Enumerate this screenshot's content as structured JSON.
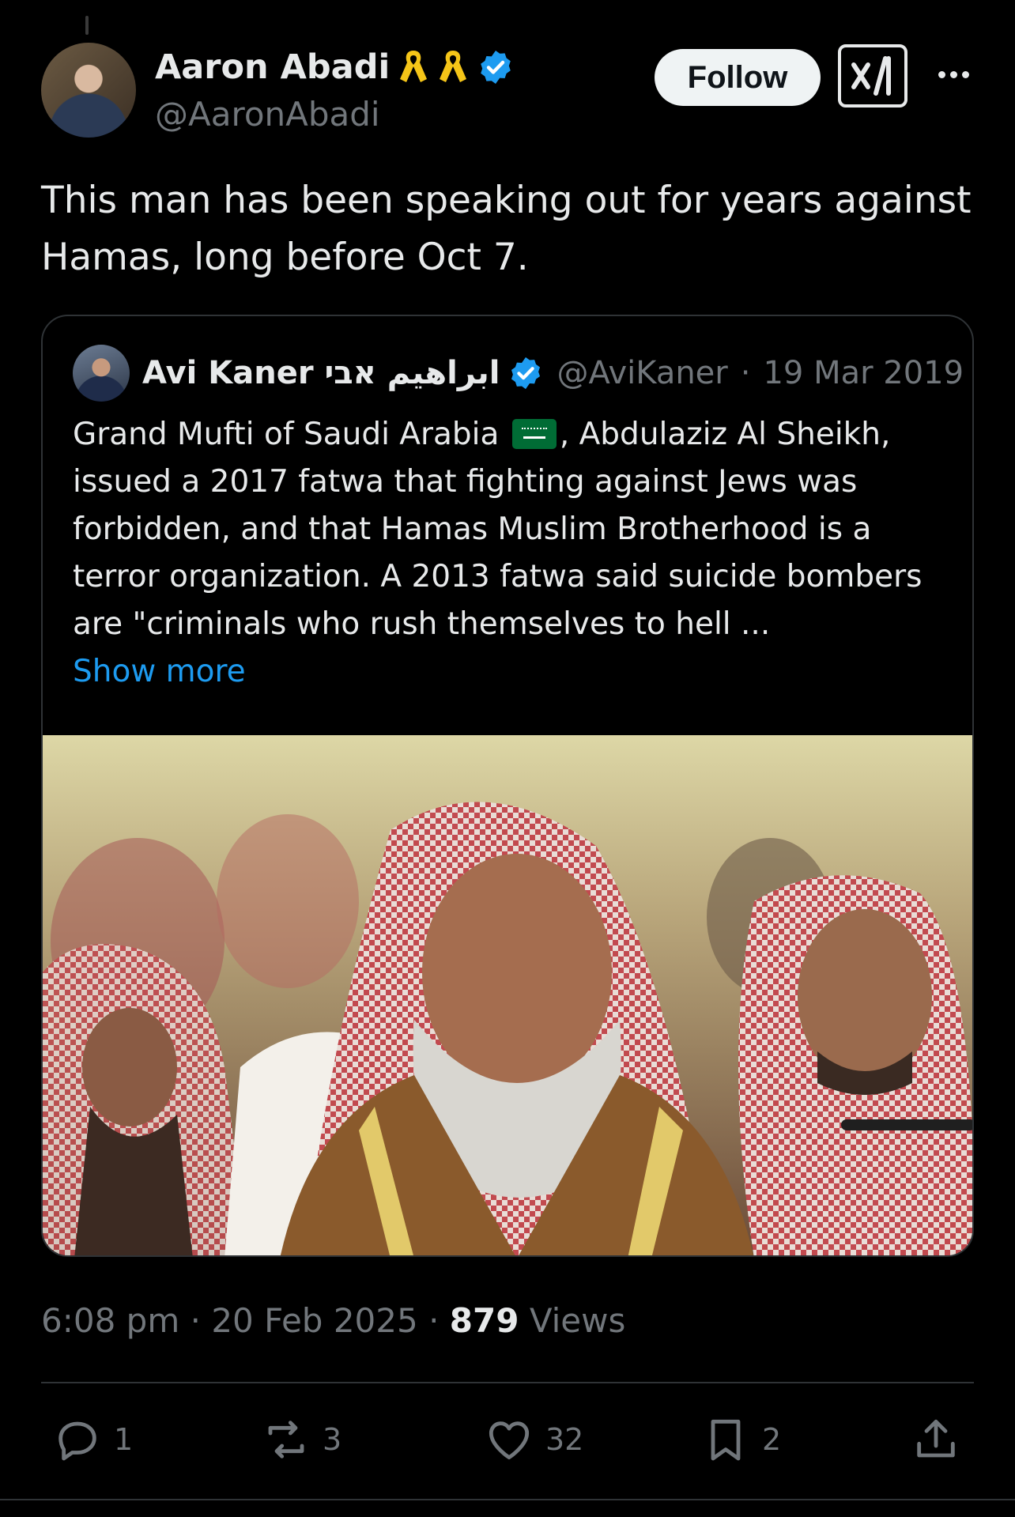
{
  "author": {
    "name": "Aaron Abadi",
    "handle": "@AaronAbadi",
    "badges": [
      "yellow-ribbon-icon",
      "yellow-ribbon-icon",
      "verified-badge-icon"
    ]
  },
  "header": {
    "follow_label": "Follow",
    "grok_icon": "grok-icon",
    "more_icon": "more-icon"
  },
  "tweet": {
    "text": "This man has been speaking out for years against Hamas, long before Oct 7."
  },
  "quote": {
    "author_name": "Avi Kaner ابراهيم אבי",
    "handle": "@AviKaner",
    "separator": "·",
    "date": "19 Mar 2019",
    "text_part1": "Grand Mufti of Saudi Arabia",
    "text_part2": ", Abdulaziz Al Sheikh, issued a 2017 fatwa that fighting against Jews was forbidden, and that Hamas Muslim Brotherhood is a terror organization. A 2013 fatwa said suicide bombers are \"criminals who rush themselves to hell ...",
    "show_more": "Show more",
    "flag_icon": "saudi-flag-icon"
  },
  "meta": {
    "time": "6:08 pm",
    "date": "20 Feb 2025",
    "views_count": "879",
    "views_label": "Views"
  },
  "actions": {
    "replies": "1",
    "reposts": "3",
    "likes": "32",
    "bookmarks": "2"
  },
  "colors": {
    "background": "#000000",
    "text": "#e7e9ea",
    "muted": "#71767b",
    "link": "#1d9bf0",
    "verified": "#1d9bf0",
    "ribbon": "#f5c518"
  }
}
